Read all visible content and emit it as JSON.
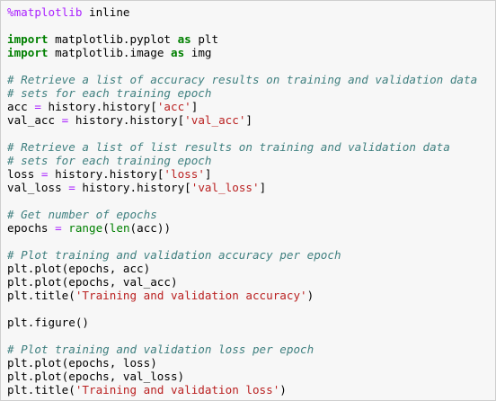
{
  "lines": [
    [
      {
        "t": "%matplotlib",
        "c": "magic"
      },
      {
        "t": " inline",
        "c": "hd"
      }
    ],
    [],
    [
      {
        "t": "import",
        "c": "kw"
      },
      {
        "t": " matplotlib.pyplot ",
        "c": "hd"
      },
      {
        "t": "as",
        "c": "kw"
      },
      {
        "t": " plt",
        "c": "hd"
      }
    ],
    [
      {
        "t": "import",
        "c": "kw"
      },
      {
        "t": " matplotlib.image ",
        "c": "hd"
      },
      {
        "t": "as",
        "c": "kw"
      },
      {
        "t": " img",
        "c": "hd"
      }
    ],
    [],
    [
      {
        "t": "# Retrieve a list of accuracy results on training and validation data",
        "c": "cm"
      }
    ],
    [
      {
        "t": "# sets for each training epoch",
        "c": "cm"
      }
    ],
    [
      {
        "t": "acc ",
        "c": "hd"
      },
      {
        "t": "=",
        "c": "op"
      },
      {
        "t": " history.history[",
        "c": "hd"
      },
      {
        "t": "'acc'",
        "c": "str"
      },
      {
        "t": "]",
        "c": "hd"
      }
    ],
    [
      {
        "t": "val_acc ",
        "c": "hd"
      },
      {
        "t": "=",
        "c": "op"
      },
      {
        "t": " history.history[",
        "c": "hd"
      },
      {
        "t": "'val_acc'",
        "c": "str"
      },
      {
        "t": "]",
        "c": "hd"
      }
    ],
    [],
    [
      {
        "t": "# Retrieve a list of list results on training and validation data",
        "c": "cm"
      }
    ],
    [
      {
        "t": "# sets for each training epoch",
        "c": "cm"
      }
    ],
    [
      {
        "t": "loss ",
        "c": "hd"
      },
      {
        "t": "=",
        "c": "op"
      },
      {
        "t": " history.history[",
        "c": "hd"
      },
      {
        "t": "'loss'",
        "c": "str"
      },
      {
        "t": "]",
        "c": "hd"
      }
    ],
    [
      {
        "t": "val_loss ",
        "c": "hd"
      },
      {
        "t": "=",
        "c": "op"
      },
      {
        "t": " history.history[",
        "c": "hd"
      },
      {
        "t": "'val_loss'",
        "c": "str"
      },
      {
        "t": "]",
        "c": "hd"
      }
    ],
    [],
    [
      {
        "t": "# Get number of epochs",
        "c": "cm"
      }
    ],
    [
      {
        "t": "epochs ",
        "c": "hd"
      },
      {
        "t": "=",
        "c": "op"
      },
      {
        "t": " ",
        "c": "hd"
      },
      {
        "t": "range",
        "c": "bi"
      },
      {
        "t": "(",
        "c": "hd"
      },
      {
        "t": "len",
        "c": "bi"
      },
      {
        "t": "(acc))",
        "c": "hd"
      }
    ],
    [],
    [
      {
        "t": "# Plot training and validation accuracy per epoch",
        "c": "cm"
      }
    ],
    [
      {
        "t": "plt.plot(epochs, acc)",
        "c": "hd"
      }
    ],
    [
      {
        "t": "plt.plot(epochs, val_acc)",
        "c": "hd"
      }
    ],
    [
      {
        "t": "plt.title(",
        "c": "hd"
      },
      {
        "t": "'Training and validation accuracy'",
        "c": "str"
      },
      {
        "t": ")",
        "c": "hd"
      }
    ],
    [],
    [
      {
        "t": "plt.figure()",
        "c": "hd"
      }
    ],
    [],
    [
      {
        "t": "# Plot training and validation loss per epoch",
        "c": "cm"
      }
    ],
    [
      {
        "t": "plt.plot(epochs, loss)",
        "c": "hd"
      }
    ],
    [
      {
        "t": "plt.plot(epochs, val_loss)",
        "c": "hd"
      }
    ],
    [
      {
        "t": "plt.title(",
        "c": "hd"
      },
      {
        "t": "'Training and validation loss'",
        "c": "str"
      },
      {
        "t": ")",
        "c": "hd"
      }
    ]
  ]
}
